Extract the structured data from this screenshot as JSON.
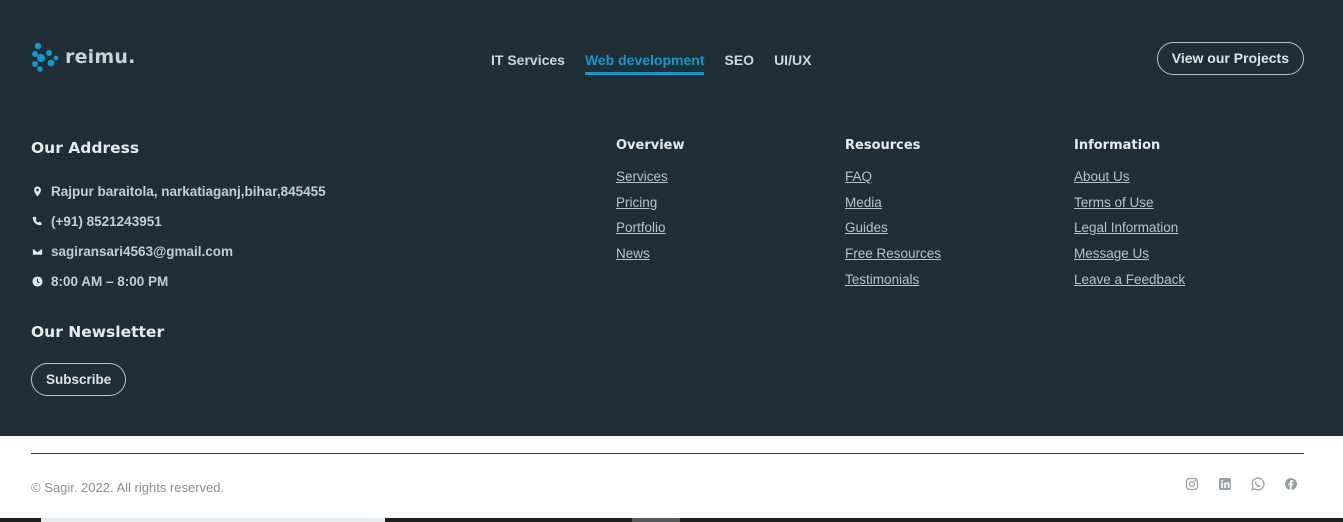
{
  "brand": {
    "name": "reimu.",
    "logo_color": "#1598c9"
  },
  "topnav": {
    "items": [
      {
        "label": "IT Services",
        "active": false
      },
      {
        "label": "Web development",
        "active": true
      },
      {
        "label": "SEO",
        "active": false
      },
      {
        "label": "UI/UX",
        "active": false
      }
    ],
    "accent": "#1598c9"
  },
  "projects_button": "View our Projects",
  "address": {
    "title": "Our Address",
    "items": [
      {
        "icon": "location-pin-icon",
        "text": "Rajpur baraitola, narkatiaganj,bihar,845455"
      },
      {
        "icon": "phone-icon",
        "text": "(+91) 8521243951"
      },
      {
        "icon": "mail-icon",
        "text": "sagiransari4563@gmail.com"
      },
      {
        "icon": "clock-icon",
        "text": "8:00 AM – 8:00 PM"
      }
    ]
  },
  "newsletter": {
    "title": "Our Newsletter",
    "button": "Subscribe"
  },
  "columns": [
    {
      "title": "Overview",
      "links": [
        "Services",
        "Pricing",
        "Portfolio",
        "News"
      ]
    },
    {
      "title": "Resources",
      "links": [
        "FAQ",
        "Media",
        "Guides",
        "Free Resources",
        "Testimonials"
      ]
    },
    {
      "title": "Information",
      "links": [
        "About Us",
        "Terms of Use",
        "Legal Information",
        "Message Us",
        "Leave a Feedback"
      ]
    }
  ],
  "copyright": "© Sagir. 2022. All rights reserved.",
  "social": [
    "instagram-icon",
    "linkedin-icon",
    "whatsapp-icon",
    "facebook-icon"
  ],
  "colors": {
    "footer_bg": "#1f2e36",
    "bottom_bg": "#ffffff"
  }
}
